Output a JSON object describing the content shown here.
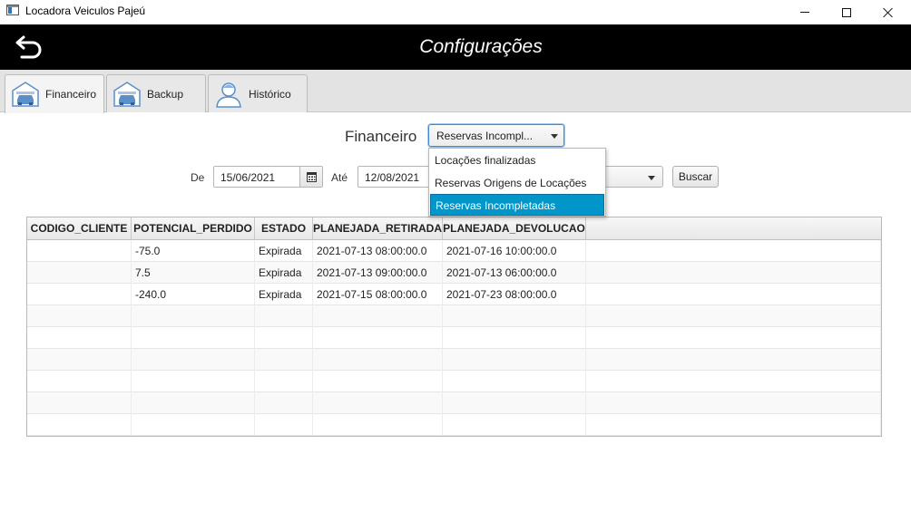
{
  "window": {
    "title": "Locadora Veiculos Pajeú"
  },
  "header": {
    "title": "Configurações"
  },
  "tabs": [
    {
      "label": "Financeiro",
      "icon": "garage-car-icon",
      "active": true
    },
    {
      "label": "Backup",
      "icon": "garage-car-icon",
      "active": false
    },
    {
      "label": "Histórico",
      "icon": "user-avatar-icon",
      "active": false
    }
  ],
  "report": {
    "label": "Financeiro",
    "selected_value": "Reservas Incompl...",
    "options": [
      "Locações finalizadas",
      "Reservas Origens de Locações",
      "Reservas Incompletadas"
    ]
  },
  "filters": {
    "from_label": "De",
    "from_value": "15/06/2021",
    "to_label": "Até",
    "to_value": "12/08/2021",
    "search_label": "Buscar"
  },
  "table": {
    "columns": [
      "CODIGO_CLIENTE",
      "POTENCIAL_PERDIDO",
      "ESTADO",
      "PLANEJADA_RETIRADA",
      "PLANEJADA_DEVOLUCAO"
    ],
    "rows": [
      [
        "",
        "-75.0",
        "Expirada",
        "2021-07-13 08:00:00.0",
        "2021-07-16 10:00:00.0"
      ],
      [
        "",
        "7.5",
        "Expirada",
        "2021-07-13 09:00:00.0",
        "2021-07-13 06:00:00.0"
      ],
      [
        "",
        "-240.0",
        "Expirada",
        "2021-07-15 08:00:00.0",
        "2021-07-23 08:00:00.0"
      ]
    ]
  },
  "colors": {
    "header_bg": "#000000",
    "accent": "#0096c9",
    "focus_border": "#3d8ad8"
  }
}
